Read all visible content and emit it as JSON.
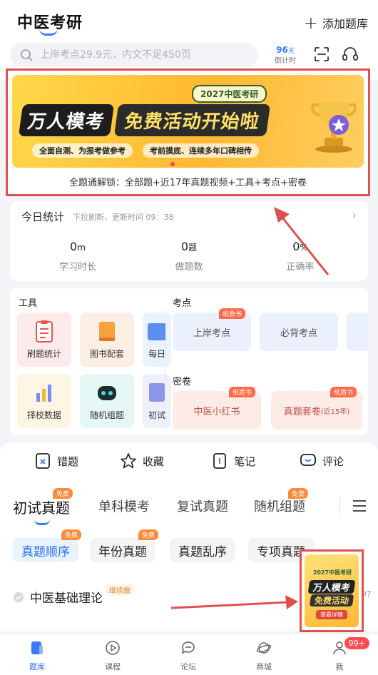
{
  "header": {
    "title": "中医考研",
    "add_label": "添加题库",
    "search_placeholder": "上岸考点29.9元，内文不足450页",
    "countdown_number": "96",
    "countdown_unit": "天",
    "countdown_label": "倒计时"
  },
  "banner": {
    "tag": "2027中医考研",
    "headline_left": "万人模考",
    "headline_right": "免费活动开始啦",
    "sub_left": "全面自测、为报考做参考",
    "sub_right": "考前摸底、连续多年口碑相传",
    "unlock_text": "全题通解锁：全部题+近17年真题视频+工具+考点+密卷"
  },
  "stats": {
    "title": "今日统计",
    "refresh_hint": "下拉刷新，更新时间 09：38",
    "items": [
      {
        "value": "0",
        "unit": "m",
        "label": "学习时长"
      },
      {
        "value": "0",
        "unit": "题",
        "label": "做题数"
      },
      {
        "value": "0",
        "unit": "%",
        "label": "正确率"
      }
    ]
  },
  "tools": {
    "title": "工具",
    "items": [
      {
        "label": "刷题统计"
      },
      {
        "label": "图书配套"
      },
      {
        "label": "每日"
      },
      {
        "label": "择校数据"
      },
      {
        "label": "随机组题"
      },
      {
        "label": "初试"
      }
    ]
  },
  "kaodian": {
    "title": "考点",
    "items": [
      {
        "label": "上岸考点",
        "tag": "纸质书"
      },
      {
        "label": "必背考点",
        "tag": ""
      }
    ]
  },
  "mijuan": {
    "title": "密卷",
    "items": [
      {
        "label": "中医小红书",
        "tag": "纸质书"
      },
      {
        "label": "真题套卷",
        "note": "(近15年)",
        "tag": "纸质书"
      }
    ]
  },
  "quick_actions": [
    {
      "label": "错题"
    },
    {
      "label": "收藏"
    },
    {
      "label": "笔记"
    },
    {
      "label": "评论"
    }
  ],
  "tabs": [
    {
      "label": "初试真题",
      "badge": "免费"
    },
    {
      "label": "单科模考",
      "badge": ""
    },
    {
      "label": "复试真题",
      "badge": ""
    },
    {
      "label": "随机组题",
      "badge": "免费"
    }
  ],
  "pills": [
    {
      "label": "真题顺序",
      "badge": "免费"
    },
    {
      "label": "年份真题",
      "badge": "免费"
    },
    {
      "label": "真题乱序",
      "badge": ""
    },
    {
      "label": "专项真题",
      "badge": ""
    }
  ],
  "subject": {
    "name": "中医基础理论",
    "continue_tag": "继续做",
    "progress": "/997"
  },
  "float_ad": {
    "tag": "2027中医考研",
    "line1": "万人模考",
    "line2": "免费活动",
    "button": "查看详情"
  },
  "nav": [
    {
      "label": "题库"
    },
    {
      "label": "课程"
    },
    {
      "label": "论坛"
    },
    {
      "label": "商城"
    },
    {
      "label": "我",
      "badge": "99+"
    }
  ],
  "colors": {
    "accent": "#2d6ef0",
    "highlight_border": "#e05050",
    "banner_yellow": "#ffc83a"
  }
}
